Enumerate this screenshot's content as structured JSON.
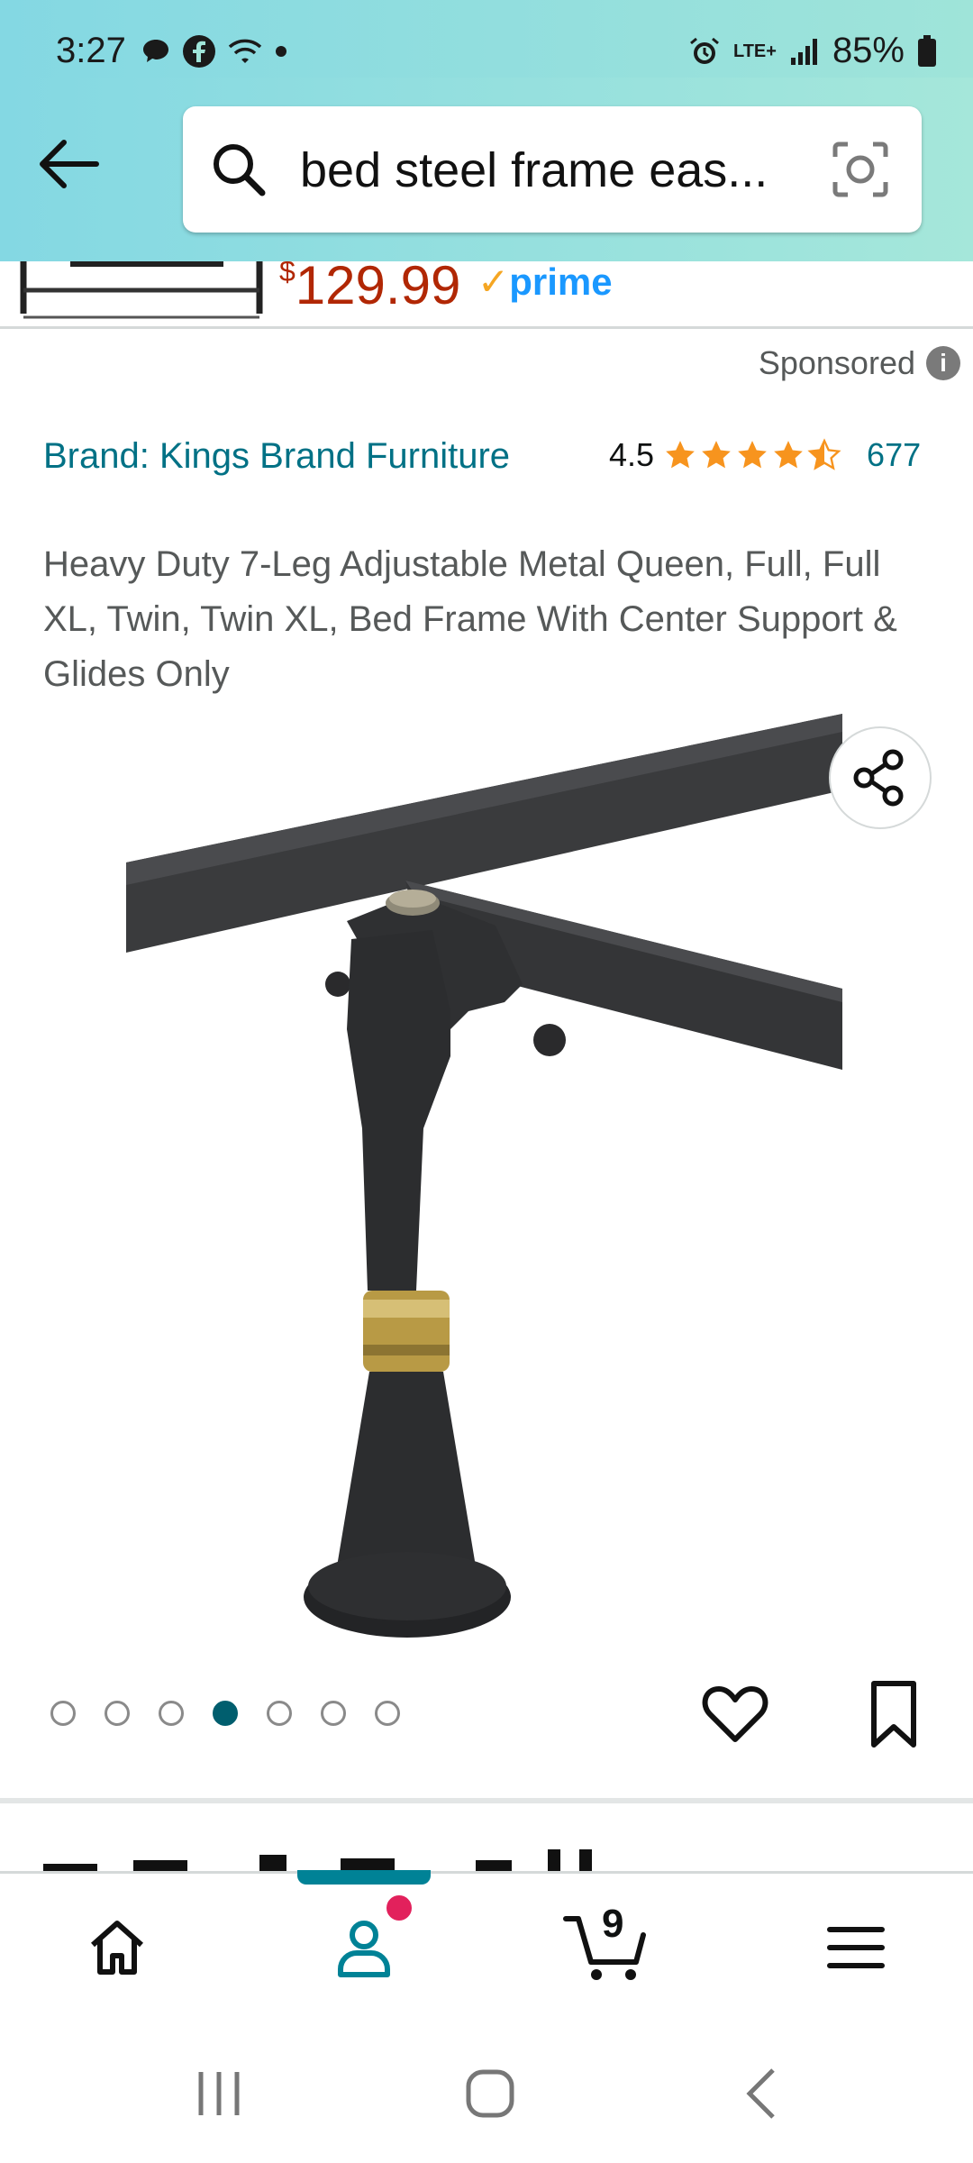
{
  "status_bar": {
    "time": "3:27",
    "network": "LTE+",
    "battery": "85%"
  },
  "search": {
    "query": "bed steel frame eas..."
  },
  "previous_result": {
    "price_symbol": "$",
    "price": "129.99",
    "prime_label": "prime"
  },
  "sponsored": {
    "label": "Sponsored"
  },
  "product": {
    "brand": "Brand: Kings Brand Furniture",
    "rating": "4.5",
    "rating_stars": 4.5,
    "rating_count": "677",
    "title": "Heavy Duty 7-Leg Adjustable Metal Queen, Full, Full XL, Twin, Twin XL, Bed Frame With Center Support & Glides Only",
    "image_count": 7,
    "active_image_index": 3
  },
  "bottom_nav": {
    "items": [
      "home",
      "account",
      "cart",
      "menu"
    ],
    "active": "account",
    "cart_count": "9"
  },
  "colors": {
    "header_gradient_start": "#84d8e3",
    "header_gradient_end": "#a5e7da",
    "link": "#007185",
    "price": "#b12704",
    "star": "#f7941e",
    "active_accent": "#008296",
    "notification": "#e2215c"
  }
}
